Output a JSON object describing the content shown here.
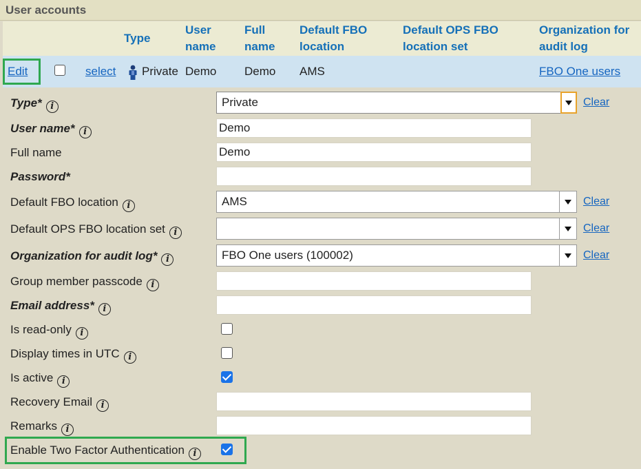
{
  "panel": {
    "title": "User accounts"
  },
  "columns": {
    "type": "Type",
    "user_name_1": "User",
    "user_name_2": "name",
    "full_name_1": "Full",
    "full_name_2": "name",
    "fbo_1": "Default FBO",
    "fbo_2": "location",
    "ops_1": "Default OPS FBO",
    "ops_2": "location set",
    "org_1": "Organization for",
    "org_2": "audit log"
  },
  "row": {
    "edit": "Edit",
    "select": "select",
    "type": "Private",
    "user_name": "Demo",
    "full_name": "Demo",
    "fbo_location": "AMS",
    "org_audit_log": "FBO One users",
    "type_icon": "person-icon"
  },
  "form": {
    "type_label": "Type*",
    "type_value": "Private",
    "user_name_label": "User name*",
    "user_name_value": "Demo",
    "full_name_label": "Full name",
    "full_name_value": "Demo",
    "password_label": "Password*",
    "password_value": "",
    "fbo_label": "Default FBO location",
    "fbo_value": "AMS",
    "ops_label": "Default OPS FBO location set",
    "ops_value": "",
    "org_label": "Organization for audit log*",
    "org_value": "FBO One users (100002)",
    "passcode_label": "Group member passcode",
    "passcode_value": "",
    "email_label": "Email address*",
    "email_value": "",
    "readonly_label": "Is read-only",
    "readonly_checked": false,
    "utc_label": "Display times in UTC",
    "utc_checked": false,
    "active_label": "Is active",
    "active_checked": true,
    "recovery_label": "Recovery Email",
    "recovery_value": "",
    "remarks_label": "Remarks",
    "remarks_value": "",
    "tfa_label": "Enable Two Factor Authentication",
    "tfa_checked": true,
    "clear": "Clear",
    "info_glyph": "i"
  },
  "colors": {
    "link": "#1565c0",
    "header_text": "#1570b8",
    "highlight": "#2fa84f",
    "row_bg": "#cfe3f1",
    "check": "#1a73e8"
  }
}
